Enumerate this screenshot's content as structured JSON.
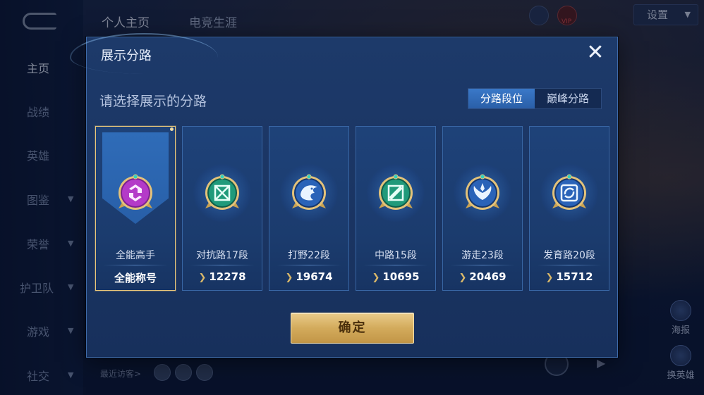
{
  "background": {
    "top_tabs": [
      "个人主页",
      "电竞生涯"
    ],
    "nav_items": [
      {
        "label": "主页",
        "active": true,
        "has_caret": false
      },
      {
        "label": "战绩",
        "active": false,
        "has_caret": false
      },
      {
        "label": "英雄",
        "active": false,
        "has_caret": false
      },
      {
        "label": "图鉴",
        "active": false,
        "has_caret": true
      },
      {
        "label": "荣誉",
        "active": false,
        "has_caret": true
      },
      {
        "label": "护卫队",
        "active": false,
        "has_caret": true
      },
      {
        "label": "游戏",
        "active": false,
        "has_caret": true
      },
      {
        "label": "社交",
        "active": false,
        "has_caret": true
      }
    ],
    "vip_label": "VIP",
    "settings_label": "设置",
    "side_buttons": [
      {
        "label": "海报",
        "icon": "poster-icon"
      },
      {
        "label": "换英雄",
        "icon": "swap-hero-icon"
      }
    ],
    "recent_visitors_label": "最近访客>"
  },
  "modal": {
    "title": "展示分路",
    "subtitle": "请选择展示的分路",
    "segment": [
      {
        "label": "分路段位",
        "active": true
      },
      {
        "label": "巅峰分路",
        "active": false
      }
    ],
    "cards": [
      {
        "name": "全能高手",
        "value": "全能称号",
        "selected": true,
        "badge_color": "#b43ac8",
        "icon": "all-round-emblem-icon"
      },
      {
        "name": "对抗路17段",
        "value": "12278",
        "selected": false,
        "badge_color": "#1f9a7a",
        "icon": "clash-lane-emblem-icon"
      },
      {
        "name": "打野22段",
        "value": "19674",
        "selected": false,
        "badge_color": "#2a63b8",
        "icon": "jungle-emblem-icon"
      },
      {
        "name": "中路15段",
        "value": "10695",
        "selected": false,
        "badge_color": "#1f9a7a",
        "icon": "mid-lane-emblem-icon"
      },
      {
        "name": "游走23段",
        "value": "20469",
        "selected": false,
        "badge_color": "#2a63b8",
        "icon": "roam-emblem-icon"
      },
      {
        "name": "发育路20段",
        "value": "15712",
        "selected": false,
        "badge_color": "#2a63b8",
        "icon": "farm-lane-emblem-icon"
      }
    ],
    "confirm_label": "确定",
    "close_symbol": "✕"
  }
}
